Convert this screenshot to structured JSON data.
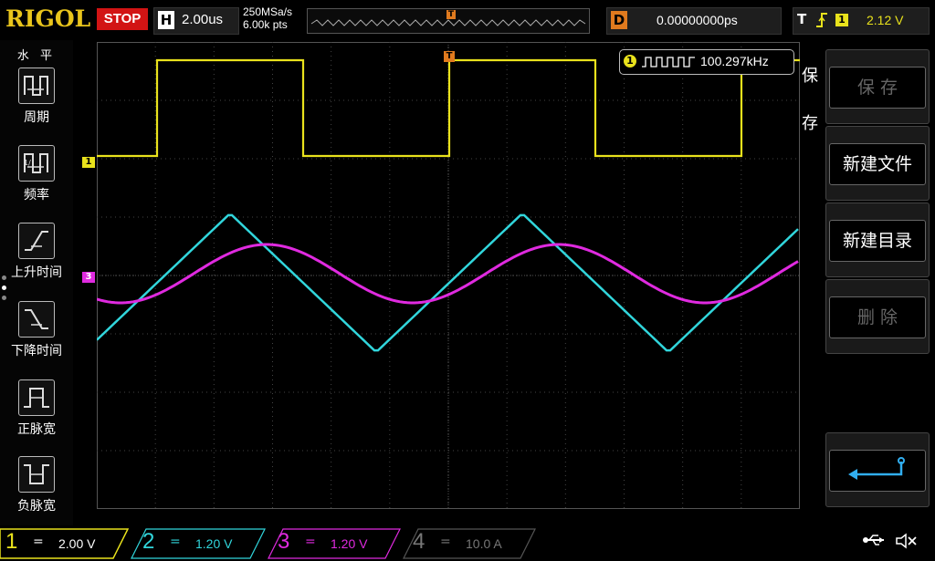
{
  "header": {
    "logo": "RIGOL",
    "run_status": "STOP",
    "horizontal_label": "H",
    "timebase": "2.00us",
    "sample_rate": "250MSa/s",
    "memory_depth": "6.00k pts",
    "delay_label": "D",
    "delay_value": "0.00000000ps",
    "trigger_label": "T",
    "trigger_source": "1",
    "trigger_level": "2.12 V"
  },
  "left_menu": {
    "title": "水 平",
    "items": [
      {
        "label": "周期",
        "icon": "period-icon"
      },
      {
        "label": "频率",
        "icon": "frequency-icon"
      },
      {
        "label": "上升时间",
        "icon": "rise-time-icon"
      },
      {
        "label": "下降时间",
        "icon": "fall-time-icon"
      },
      {
        "label": "正脉宽",
        "icon": "positive-width-icon"
      },
      {
        "label": "负脉宽",
        "icon": "negative-width-icon"
      }
    ]
  },
  "display": {
    "ch1_marker": "1",
    "ch3_marker": "3",
    "trigger_marker": "T",
    "frequency_channel": "1",
    "frequency_value": "100.297kHz"
  },
  "right_menu": {
    "title": "保存",
    "buttons": [
      {
        "label": "保 存",
        "disabled": true
      },
      {
        "label": "新建文件",
        "disabled": false
      },
      {
        "label": "新建目录",
        "disabled": false
      },
      {
        "label": "删 除",
        "disabled": true
      }
    ],
    "back_icon": "return-arrow-icon"
  },
  "channels": [
    {
      "num": "1",
      "coupling": "=",
      "scale": "2.00 V",
      "color": "#e9e21c"
    },
    {
      "num": "2",
      "coupling": "=",
      "scale": "1.20 V",
      "color": "#31d6dc"
    },
    {
      "num": "3",
      "coupling": "=",
      "scale": "1.20 V",
      "color": "#e02ae0"
    },
    {
      "num": "4",
      "coupling": "=",
      "scale": "10.0 A",
      "color": "#777777"
    }
  ],
  "status_icons": [
    "usb-icon",
    "mute-icon"
  ]
}
